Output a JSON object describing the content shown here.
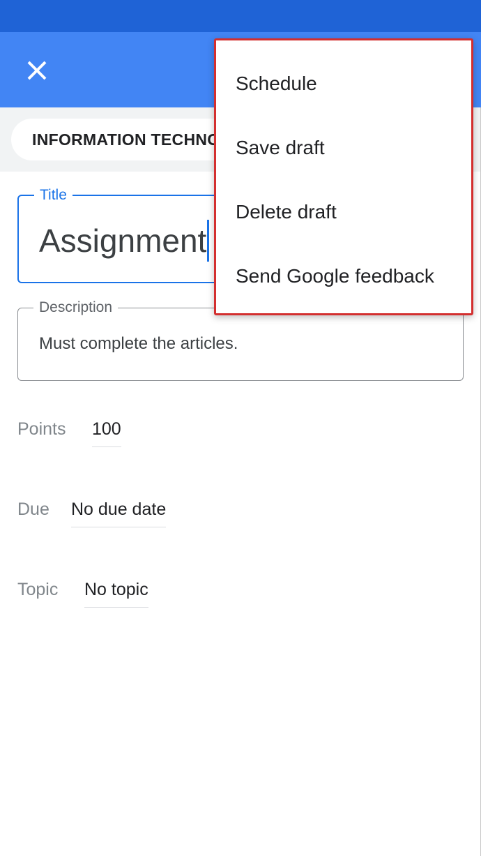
{
  "header": {
    "close_icon": "close-icon",
    "class_chip_label": "INFORMATION TECHNOLOGY"
  },
  "form": {
    "title_label": "Title",
    "title_value": "Assignment",
    "description_label": "Description",
    "description_value": "Must complete the articles.",
    "points_label": "Points",
    "points_value": "100",
    "due_label": "Due",
    "due_value": "No due date",
    "topic_label": "Topic",
    "topic_value": "No topic"
  },
  "menu": {
    "items": [
      {
        "label": "Schedule"
      },
      {
        "label": "Save draft"
      },
      {
        "label": "Delete draft"
      },
      {
        "label": "Send Google feedback"
      }
    ]
  },
  "colors": {
    "status_bar": "#1f63d6",
    "app_bar": "#4285f4",
    "accent": "#1a73e8",
    "highlight_border": "#d32f2f"
  }
}
